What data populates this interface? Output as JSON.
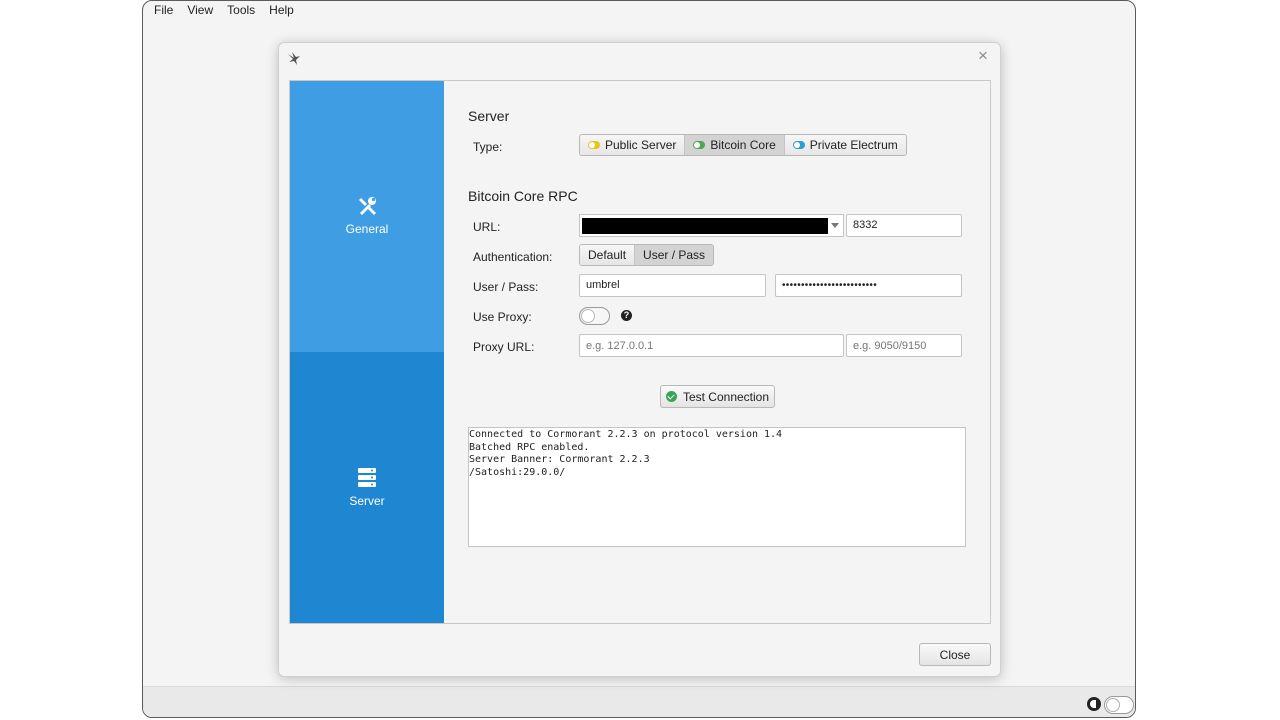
{
  "menubar": {
    "items": [
      "File",
      "View",
      "Tools",
      "Help"
    ]
  },
  "dialog": {
    "close_glyph": "×",
    "sidebar": [
      {
        "label": "General",
        "icon": "tools-icon"
      },
      {
        "label": "Server",
        "icon": "server-icon"
      }
    ],
    "server_section": {
      "title": "Server",
      "type_label": "Type:",
      "types": [
        {
          "label": "Public Server",
          "dot_color": "#e6c716",
          "selected": false
        },
        {
          "label": "Bitcoin Core",
          "dot_color": "#4fa84f",
          "selected": true
        },
        {
          "label": "Private Electrum",
          "dot_color": "#2a9fd6",
          "selected": false
        }
      ]
    },
    "rpc_section": {
      "title": "Bitcoin Core RPC",
      "url_label": "URL:",
      "url_value": "",
      "port_value": "8332",
      "auth_label": "Authentication:",
      "auth_options": [
        {
          "label": "Default",
          "selected": false
        },
        {
          "label": "User / Pass",
          "selected": true
        }
      ],
      "userpass_label": "User / Pass:",
      "user_value": "umbrel",
      "pass_value": "•••••••••••••••••••••••••",
      "proxy_label": "Use Proxy:",
      "proxy_enabled": false,
      "proxy_help_glyph": "?",
      "proxy_url_label": "Proxy URL:",
      "proxy_host_placeholder": "e.g. 127.0.0.1",
      "proxy_port_placeholder": "e.g. 9050/9150"
    },
    "test_button_label": "Test Connection",
    "log_lines": [
      "Connected to Cormorant 2.2.3 on protocol version 1.4",
      "Batched RPC enabled.",
      "Server Banner: Cormorant 2.2.3",
      "/Satoshi:29.0.0/"
    ],
    "close_button_label": "Close"
  }
}
